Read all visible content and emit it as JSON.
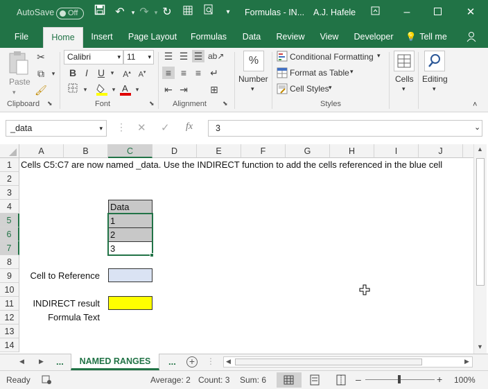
{
  "titlebar": {
    "autosave": "AutoSave",
    "autosave_state": "Off",
    "doc_title": "Formulas - IN...",
    "user": "A.J. Hafele"
  },
  "tabs": [
    "File",
    "Home",
    "Insert",
    "Page Layout",
    "Formulas",
    "Data",
    "Review",
    "View",
    "Developer",
    "Tell me"
  ],
  "ribbon": {
    "clipboard": {
      "paste": "Paste",
      "label": "Clipboard"
    },
    "font": {
      "name": "Calibri",
      "size": "11",
      "label": "Font"
    },
    "alignment": {
      "label": "Alignment"
    },
    "number": {
      "label": "Number",
      "icon_text": "%"
    },
    "styles": {
      "conditional": "Conditional Formatting",
      "table": "Format as Table",
      "cell_styles": "Cell Styles",
      "label": "Styles"
    },
    "cells": {
      "label": "Cells"
    },
    "editing": {
      "label": "Editing"
    }
  },
  "formula_bar": {
    "name_box": "_data",
    "formula": "3"
  },
  "columns": [
    "A",
    "B",
    "C",
    "D",
    "E",
    "F",
    "G",
    "H",
    "I",
    "J"
  ],
  "rows": [
    "1",
    "2",
    "3",
    "4",
    "5",
    "6",
    "7",
    "8",
    "9",
    "10",
    "11",
    "12",
    "13",
    "14"
  ],
  "cells": {
    "a1": "Cells C5:C7 are now named _data.  Use the INDIRECT function to add the cells referenced in the blue cell",
    "c4": "Data",
    "c5": "1",
    "c6": "2",
    "c7": "3",
    "b9": "Cell to Reference",
    "b11": "INDIRECT result",
    "b12": "Formula Text"
  },
  "colors": {
    "accent": "#217346",
    "header_fill": "#c8c8c8",
    "blue_cell": "#dae3f3",
    "yellow_cell": "#ffff00"
  },
  "sheet_tabs": {
    "prev_dots": "...",
    "active": "NAMED RANGES",
    "next_dots": "..."
  },
  "status": {
    "mode": "Ready",
    "average": "Average: 2",
    "count": "Count: 3",
    "sum": "Sum: 6",
    "zoom": "100%"
  }
}
